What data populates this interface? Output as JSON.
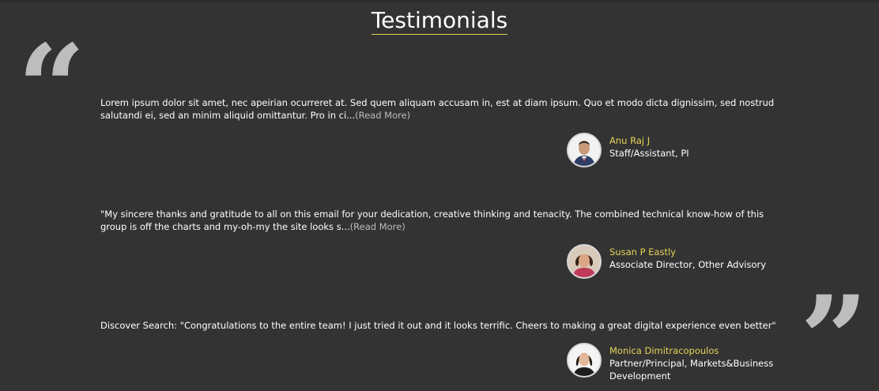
{
  "section": {
    "title": "Testimonials",
    "accent_color": "#e6d35a",
    "quote_open_glyph": "“",
    "quote_close_glyph": "”"
  },
  "testimonials": [
    {
      "text": "Lorem ipsum dolor sit amet, nec apeirian ocurreret at. Sed quem aliquam accusam in, est at diam ipsum. Quo et modo dicta dignissim, sed nostrud salutandi ei, sed an minim aliquid omittantur. Pro in ci...",
      "read_more": "(Read More)",
      "name": "Anu Raj J",
      "role": "Staff/Assistant, PI"
    },
    {
      "text": "\"My sincere thanks and gratitude to all on this email for your dedication, creative thinking and tenacity. The combined technical know-how of this group is off the charts and my-oh-my the site looks s...",
      "read_more": "(Read More)",
      "name": "Susan P Eastly",
      "role": "Associate Director, Other Advisory"
    },
    {
      "text": "Discover Search: \"Congratulations to the entire team! I just tried it out and it looks terrific. Cheers to making a great digital experience even better\"",
      "read_more": "",
      "name": "Monica Dimitracopoulos",
      "role": "Partner/Principal, Markets&Business Development"
    }
  ]
}
